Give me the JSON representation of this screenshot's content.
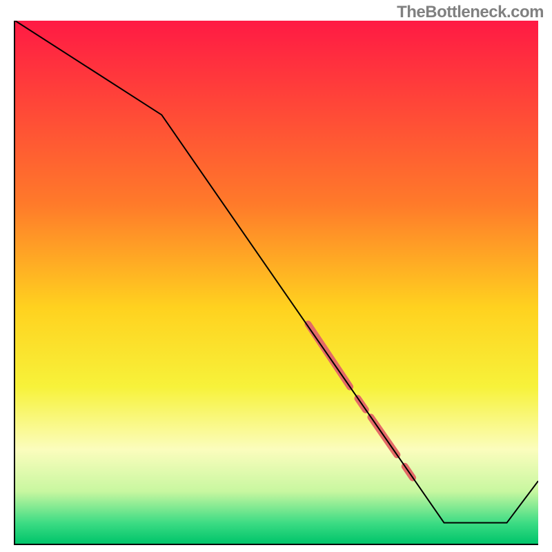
{
  "watermark": "TheBottleneck.com",
  "chart_data": {
    "type": "line",
    "title": "",
    "xlabel": "",
    "ylabel": "",
    "xlim": [
      0,
      100
    ],
    "ylim": [
      0,
      100
    ],
    "background_gradient": {
      "stops": [
        {
          "offset": 0,
          "color": "#ff1a44"
        },
        {
          "offset": 35,
          "color": "#ff7a2a"
        },
        {
          "offset": 55,
          "color": "#ffd21f"
        },
        {
          "offset": 70,
          "color": "#f7f23a"
        },
        {
          "offset": 82,
          "color": "#fbfdbd"
        },
        {
          "offset": 90,
          "color": "#c8f7a0"
        },
        {
          "offset": 96,
          "color": "#3ddc84"
        },
        {
          "offset": 100,
          "color": "#00c46a"
        }
      ]
    },
    "series": [
      {
        "name": "bottleneck-curve",
        "type": "line",
        "color": "#000000",
        "width": 2,
        "points": [
          {
            "x": 0,
            "y": 100
          },
          {
            "x": 28,
            "y": 82
          },
          {
            "x": 82,
            "y": 4
          },
          {
            "x": 94,
            "y": 4
          },
          {
            "x": 100,
            "y": 12
          }
        ]
      },
      {
        "name": "highlight-segments",
        "type": "line-overlay",
        "color": "#e36a66",
        "width": 10,
        "cap": "round",
        "segments": [
          {
            "x1": 56,
            "y1": 42,
            "x2": 64,
            "y2": 30
          },
          {
            "x1": 65.5,
            "y1": 27.8,
            "x2": 67,
            "y2": 25.6
          },
          {
            "x1": 68,
            "y1": 24.2,
            "x2": 73,
            "y2": 17
          },
          {
            "x1": 74.5,
            "y1": 14.8,
            "x2": 76,
            "y2": 12.6
          }
        ]
      }
    ]
  }
}
